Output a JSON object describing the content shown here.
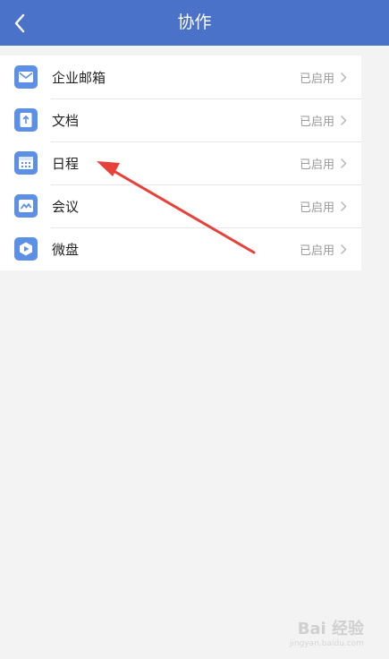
{
  "header": {
    "title": "协作",
    "back_icon": "chevron-left-icon"
  },
  "items": [
    {
      "label": "企业邮箱",
      "status": "已启用",
      "icon": "mail-icon"
    },
    {
      "label": "文档",
      "status": "已启用",
      "icon": "document-icon"
    },
    {
      "label": "日程",
      "status": "已启用",
      "icon": "calendar-icon"
    },
    {
      "label": "会议",
      "status": "已启用",
      "icon": "meeting-icon"
    },
    {
      "label": "微盘",
      "status": "已启用",
      "icon": "drive-icon"
    }
  ],
  "colors": {
    "header_bg": "#4a72c9",
    "icon_bg": "#5c8fe6",
    "annotation_arrow": "#e8413a"
  },
  "watermark": {
    "text": "Bai 经验",
    "sub": "jingyan.baidu.com"
  }
}
